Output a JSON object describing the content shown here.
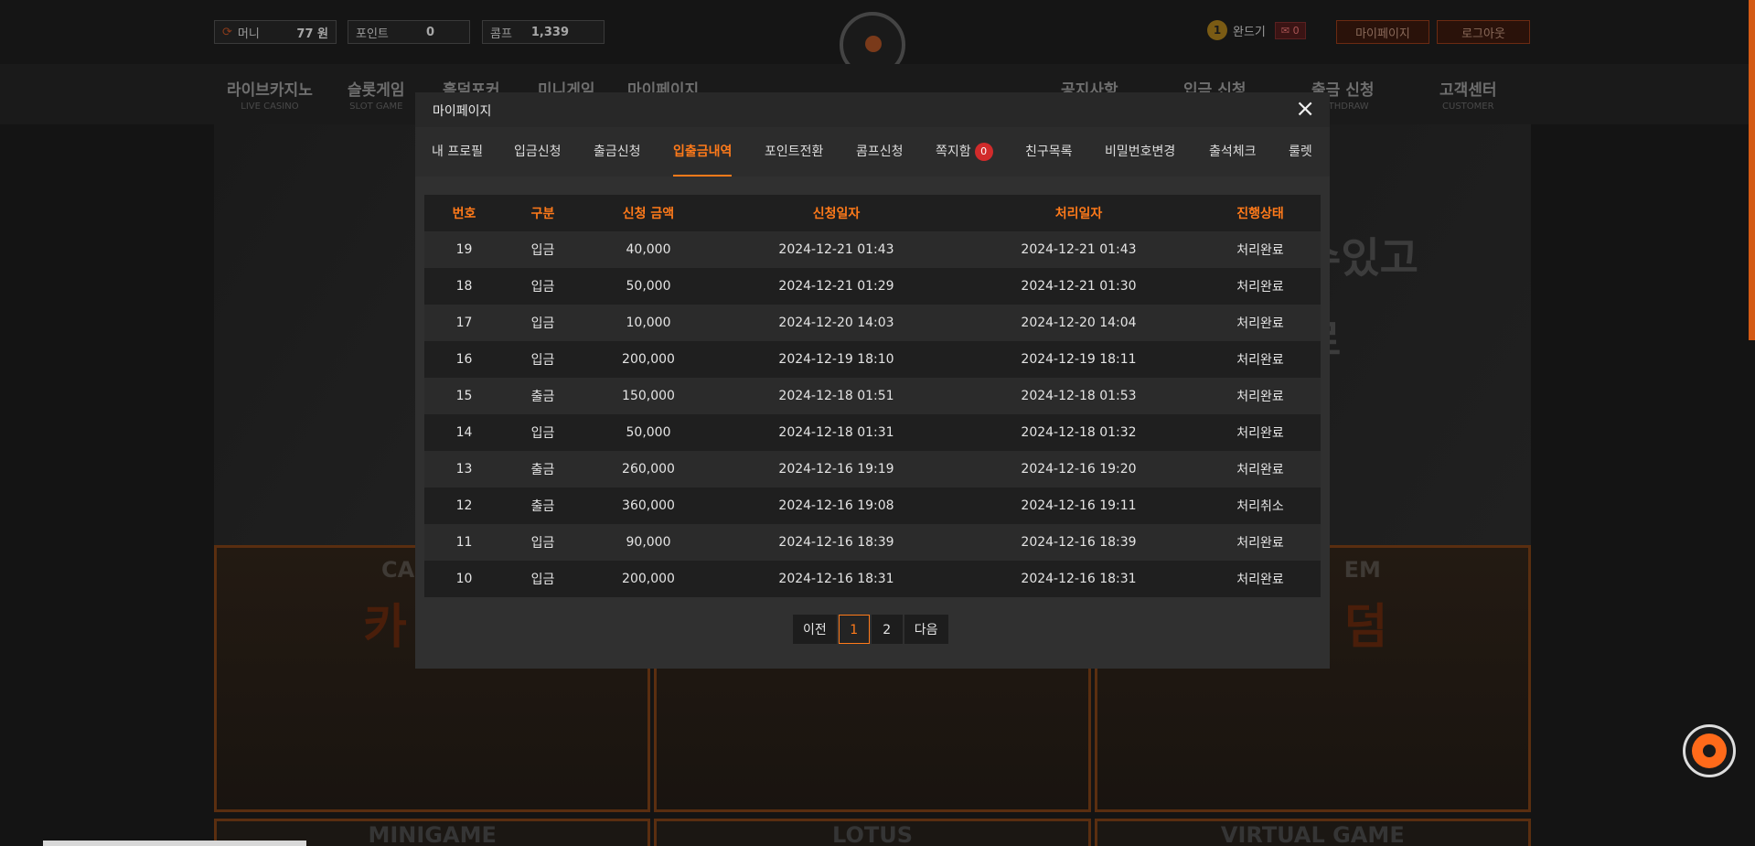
{
  "header": {
    "wallet": [
      {
        "label": "머니",
        "value": "77 원"
      },
      {
        "label": "포인트",
        "value": "0"
      },
      {
        "label": "콤프",
        "value": "1,339"
      }
    ],
    "level": "1",
    "username": "완드기",
    "message_count": "0",
    "mypage_btn": "마이페이지",
    "logout_btn": "로그아웃"
  },
  "nav": [
    {
      "ko": "라이브카지노",
      "en": "LIVE CASINO"
    },
    {
      "ko": "슬롯게임",
      "en": "SLOT GAME"
    },
    {
      "ko": "홀덤포커",
      "en": ""
    },
    {
      "ko": "미니게임",
      "en": ""
    },
    {
      "ko": "마이페이지",
      "en": ""
    },
    {
      "ko": "공지사항",
      "en": ""
    },
    {
      "ko": "입금 신청",
      "en": ""
    },
    {
      "ko": "출금 신청",
      "en": "WITHDRAW"
    },
    {
      "ko": "고객센터",
      "en": "CUSTOMER"
    }
  ],
  "hero": {
    "line1": "수있고",
    "line2": "로"
  },
  "cards": [
    {
      "tag": "CA",
      "big": "카"
    },
    {
      "tag": "",
      "big": ""
    },
    {
      "tag": "EM",
      "big": "덤"
    }
  ],
  "bottom_cards": [
    "MINIGAME",
    "LOTUS",
    "VIRTUAL GAME"
  ],
  "modal": {
    "title": "마이페이지",
    "close": "×",
    "tabs": [
      {
        "label": "내 프로필"
      },
      {
        "label": "입금신청"
      },
      {
        "label": "출금신청"
      },
      {
        "label": "입출금내역"
      },
      {
        "label": "포인트전환"
      },
      {
        "label": "콤프신청"
      },
      {
        "label": "쪽지함",
        "badge": "0"
      },
      {
        "label": "친구목록"
      },
      {
        "label": "비밀번호변경"
      },
      {
        "label": "출석체크"
      },
      {
        "label": "룰렛"
      }
    ],
    "active_tab": "입출금내역",
    "table": {
      "headers": [
        "번호",
        "구분",
        "신청 금액",
        "신청일자",
        "처리일자",
        "진행상태"
      ],
      "rows": [
        [
          "19",
          "입금",
          "40,000",
          "2024-12-21 01:43",
          "2024-12-21 01:43",
          "처리완료"
        ],
        [
          "18",
          "입금",
          "50,000",
          "2024-12-21 01:29",
          "2024-12-21 01:30",
          "처리완료"
        ],
        [
          "17",
          "입금",
          "10,000",
          "2024-12-20 14:03",
          "2024-12-20 14:04",
          "처리완료"
        ],
        [
          "16",
          "입금",
          "200,000",
          "2024-12-19 18:10",
          "2024-12-19 18:11",
          "처리완료"
        ],
        [
          "15",
          "출금",
          "150,000",
          "2024-12-18 01:51",
          "2024-12-18 01:53",
          "처리완료"
        ],
        [
          "14",
          "입금",
          "50,000",
          "2024-12-18 01:31",
          "2024-12-18 01:32",
          "처리완료"
        ],
        [
          "13",
          "출금",
          "260,000",
          "2024-12-16 19:19",
          "2024-12-16 19:20",
          "처리완료"
        ],
        [
          "12",
          "출금",
          "360,000",
          "2024-12-16 19:08",
          "2024-12-16 19:11",
          "처리취소"
        ],
        [
          "11",
          "입금",
          "90,000",
          "2024-12-16 18:39",
          "2024-12-16 18:39",
          "처리완료"
        ],
        [
          "10",
          "입금",
          "200,000",
          "2024-12-16 18:31",
          "2024-12-16 18:31",
          "처리완료"
        ]
      ]
    },
    "pager": {
      "prev": "이전",
      "pages": [
        "1",
        "2"
      ],
      "current": "1",
      "next": "다음"
    }
  },
  "colors": {
    "accent": "#ff7a1a",
    "badge": "#d12b2b"
  }
}
